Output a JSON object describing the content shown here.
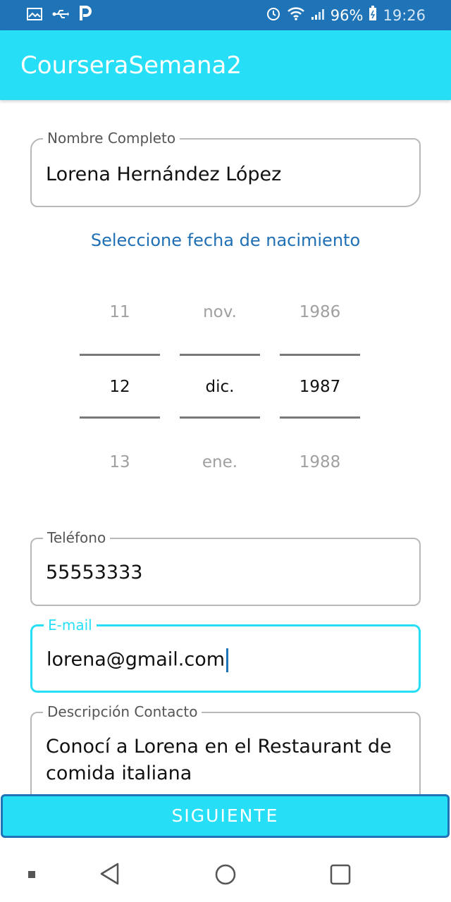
{
  "status_bar": {
    "left_icons": [
      "image-icon",
      "usb-icon",
      "p-app-icon"
    ],
    "battery_percent": "96%",
    "time": "19:26"
  },
  "app_bar": {
    "title": "CourseraSemana2"
  },
  "form": {
    "full_name": {
      "label": "Nombre Completo",
      "value": "Lorena Hernández López"
    },
    "birth_date_link": "Seleccione fecha de nacimiento",
    "date_picker": {
      "day": {
        "prev": "11",
        "selected": "12",
        "next": "13"
      },
      "month": {
        "prev": "nov.",
        "selected": "dic.",
        "next": "ene."
      },
      "year": {
        "prev": "1986",
        "selected": "1987",
        "next": "1988"
      }
    },
    "phone": {
      "label": "Teléfono",
      "value": "55553333"
    },
    "email": {
      "label": "E-mail",
      "value": "lorena@gmail.com"
    },
    "description": {
      "label": "Descripción Contacto",
      "value_line1": "Conocí a Lorena en el Restaurant de",
      "value_line2": "comida italiana"
    }
  },
  "next_button": {
    "label": "SIGUIENTE"
  },
  "colors": {
    "accent": "#26dff6",
    "status_bar": "#1f74b8",
    "link": "#1f6fb5"
  }
}
